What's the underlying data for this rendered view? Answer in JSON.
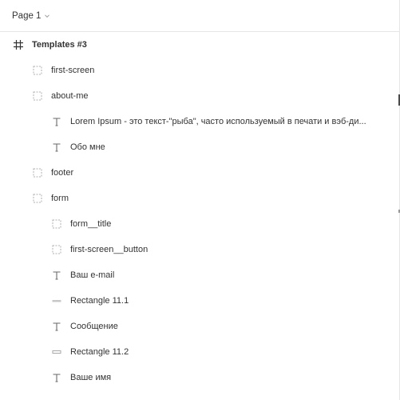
{
  "page_selector": {
    "label": "Page 1"
  },
  "layers": [
    {
      "label": "Templates #3",
      "icon": "frame-icon",
      "level": 0
    },
    {
      "label": "first-screen",
      "icon": "group-icon",
      "level": 1
    },
    {
      "label": "about-me",
      "icon": "group-icon",
      "level": 1
    },
    {
      "label": "Lorem Ipsum - это текст-\"рыба\", часто используемый в печати и вэб-ди...",
      "icon": "text-icon",
      "level": 2
    },
    {
      "label": "Обо мне",
      "icon": "text-icon",
      "level": 2
    },
    {
      "label": "footer",
      "icon": "group-icon",
      "level": 1
    },
    {
      "label": "form",
      "icon": "group-icon",
      "level": 1
    },
    {
      "label": "form__title",
      "icon": "group-icon",
      "level": 2
    },
    {
      "label": "first-screen__button",
      "icon": "group-icon",
      "level": 2
    },
    {
      "label": "Ваш e-mail",
      "icon": "text-icon",
      "level": 2
    },
    {
      "label": "Rectangle 11.1",
      "icon": "rectangle-filled-icon",
      "level": 2
    },
    {
      "label": "Сообщение",
      "icon": "text-icon",
      "level": 2
    },
    {
      "label": "Rectangle 11.2",
      "icon": "rectangle-outline-icon",
      "level": 2
    },
    {
      "label": "Ваше имя",
      "icon": "text-icon",
      "level": 2
    }
  ]
}
